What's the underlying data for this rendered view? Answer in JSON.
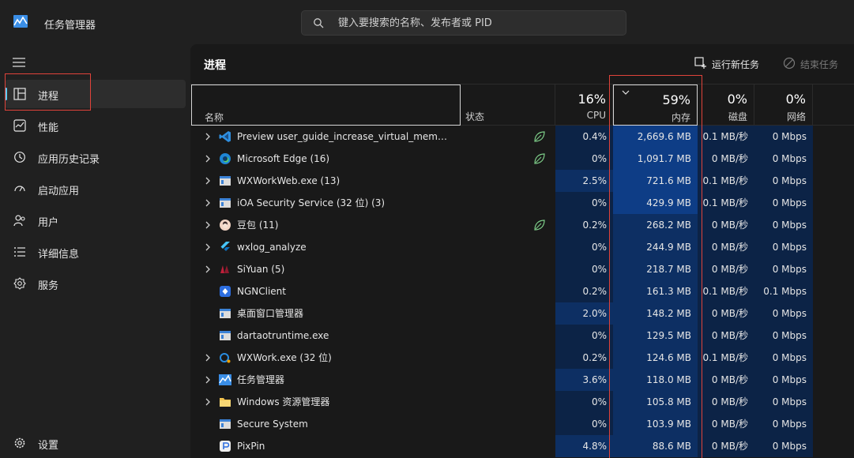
{
  "app": {
    "title": "任务管理器",
    "search_placeholder": "键入要搜索的名称、发布者或 PID"
  },
  "sidebar": {
    "items": [
      {
        "label": "进程",
        "icon": "processes-icon",
        "active": true
      },
      {
        "label": "性能",
        "icon": "performance-icon"
      },
      {
        "label": "应用历史记录",
        "icon": "app-history-icon"
      },
      {
        "label": "启动应用",
        "icon": "startup-apps-icon"
      },
      {
        "label": "用户",
        "icon": "users-icon"
      },
      {
        "label": "详细信息",
        "icon": "details-icon"
      },
      {
        "label": "服务",
        "icon": "services-icon"
      }
    ],
    "settings_label": "设置"
  },
  "main": {
    "title": "进程",
    "run_new_task": "运行新任务",
    "end_task": "结束任务"
  },
  "columns": {
    "name": "名称",
    "status": "状态",
    "cpu": {
      "pct": "16%",
      "label": "CPU"
    },
    "memory": {
      "pct": "59%",
      "label": "内存"
    },
    "disk": {
      "pct": "0%",
      "label": "磁盘"
    },
    "network": {
      "pct": "0%",
      "label": "网络"
    }
  },
  "colors": {
    "accent": "#60cdff",
    "heat_low": "#0b2547",
    "heat_mid": "#0d3474",
    "heat_high": "#123f8c",
    "highlight_box": "#e0433a"
  },
  "processes": [
    {
      "name": "Preview user_guide_increase_virtual_memory....",
      "icon": "vscode-icon",
      "expandable": true,
      "eco": true,
      "cpu": "0.4%",
      "memory": "2,669.6 MB",
      "disk": "0.1 MB/秒",
      "network": "0 Mbps",
      "cpu_heat": 0,
      "mem_heat": 2
    },
    {
      "name": "Microsoft Edge (16)",
      "icon": "edge-icon",
      "expandable": true,
      "eco": true,
      "cpu": "0%",
      "memory": "1,091.7 MB",
      "disk": "0 MB/秒",
      "network": "0 Mbps",
      "cpu_heat": 0,
      "mem_heat": 2
    },
    {
      "name": "WXWorkWeb.exe (13)",
      "icon": "app-window-icon",
      "expandable": true,
      "eco": false,
      "cpu": "2.5%",
      "memory": "721.6 MB",
      "disk": "0.1 MB/秒",
      "network": "0 Mbps",
      "cpu_heat": 1,
      "mem_heat": 2
    },
    {
      "name": "iOA Security Service (32 位) (3)",
      "icon": "app-window-icon",
      "expandable": true,
      "eco": false,
      "cpu": "0%",
      "memory": "429.9 MB",
      "disk": "0.1 MB/秒",
      "network": "0 Mbps",
      "cpu_heat": 0,
      "mem_heat": 2
    },
    {
      "name": "豆包 (11)",
      "icon": "doubao-icon",
      "expandable": true,
      "eco": true,
      "cpu": "0.2%",
      "memory": "268.2 MB",
      "disk": "0 MB/秒",
      "network": "0 Mbps",
      "cpu_heat": 0,
      "mem_heat": 1
    },
    {
      "name": "wxlog_analyze",
      "icon": "flutter-icon",
      "expandable": true,
      "eco": false,
      "cpu": "0%",
      "memory": "244.9 MB",
      "disk": "0 MB/秒",
      "network": "0 Mbps",
      "cpu_heat": 0,
      "mem_heat": 1
    },
    {
      "name": "SiYuan (5)",
      "icon": "siyuan-icon",
      "expandable": true,
      "eco": false,
      "cpu": "0%",
      "memory": "218.7 MB",
      "disk": "0 MB/秒",
      "network": "0 Mbps",
      "cpu_heat": 0,
      "mem_heat": 1
    },
    {
      "name": "NGNClient",
      "icon": "ngn-icon",
      "expandable": false,
      "eco": false,
      "cpu": "0.2%",
      "memory": "161.3 MB",
      "disk": "0.1 MB/秒",
      "network": "0.1 Mbps",
      "cpu_heat": 0,
      "mem_heat": 1
    },
    {
      "name": "桌面窗口管理器",
      "icon": "app-window-icon",
      "expandable": false,
      "eco": false,
      "cpu": "2.0%",
      "memory": "148.2 MB",
      "disk": "0 MB/秒",
      "network": "0 Mbps",
      "cpu_heat": 1,
      "mem_heat": 1
    },
    {
      "name": "dartaotruntime.exe",
      "icon": "app-window-icon",
      "expandable": false,
      "eco": false,
      "cpu": "0%",
      "memory": "129.5 MB",
      "disk": "0 MB/秒",
      "network": "0 Mbps",
      "cpu_heat": 0,
      "mem_heat": 1
    },
    {
      "name": "WXWork.exe (32 位)",
      "icon": "wxwork-icon",
      "expandable": true,
      "eco": false,
      "cpu": "0.2%",
      "memory": "124.6 MB",
      "disk": "0.1 MB/秒",
      "network": "0 Mbps",
      "cpu_heat": 0,
      "mem_heat": 1
    },
    {
      "name": "任务管理器",
      "icon": "task-manager-icon",
      "expandable": true,
      "eco": false,
      "cpu": "3.6%",
      "memory": "118.0 MB",
      "disk": "0 MB/秒",
      "network": "0 Mbps",
      "cpu_heat": 1,
      "mem_heat": 1
    },
    {
      "name": "Windows 资源管理器",
      "icon": "folder-icon",
      "expandable": true,
      "eco": false,
      "cpu": "0%",
      "memory": "105.8 MB",
      "disk": "0 MB/秒",
      "network": "0 Mbps",
      "cpu_heat": 0,
      "mem_heat": 1
    },
    {
      "name": "Secure System",
      "icon": "app-window-icon",
      "expandable": false,
      "eco": false,
      "cpu": "0%",
      "memory": "103.9 MB",
      "disk": "0 MB/秒",
      "network": "0 Mbps",
      "cpu_heat": 0,
      "mem_heat": 1
    },
    {
      "name": "PixPin",
      "icon": "pixpin-icon",
      "expandable": false,
      "eco": false,
      "cpu": "4.8%",
      "memory": "88.6 MB",
      "disk": "0 MB/秒",
      "network": "0 Mbps",
      "cpu_heat": 1,
      "mem_heat": 1
    }
  ]
}
